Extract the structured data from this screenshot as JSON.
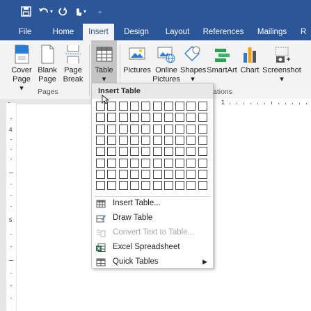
{
  "qat": {
    "save_icon": "save-icon",
    "undo_icon": "undo-icon",
    "redo_icon": "redo-icon",
    "touch_icon": "touch-mode-icon",
    "customize_icon": "customize-qat-icon"
  },
  "tabs": [
    {
      "label": "File"
    },
    {
      "label": "Home"
    },
    {
      "label": "Insert"
    },
    {
      "label": "Design"
    },
    {
      "label": "Layout"
    },
    {
      "label": "References"
    },
    {
      "label": "Mailings"
    },
    {
      "label": "R"
    }
  ],
  "ribbon": {
    "buttons": [
      {
        "label1": "Cover",
        "label2": "Page ▾"
      },
      {
        "label1": "Blank",
        "label2": "Page"
      },
      {
        "label1": "Page",
        "label2": "Break"
      },
      {
        "label1": "Table",
        "label2": "▾"
      },
      {
        "label1": "Pictures",
        "label2": ""
      },
      {
        "label1": "Online",
        "label2": "Pictures"
      },
      {
        "label1": "Shapes",
        "label2": "▾"
      },
      {
        "label1": "SmartArt",
        "label2": ""
      },
      {
        "label1": "Chart",
        "label2": ""
      },
      {
        "label1": "Screenshot",
        "label2": "▾"
      }
    ],
    "groups": {
      "pages": "Pages",
      "illustrations_partial": "ations"
    }
  },
  "dropdown": {
    "header": "Insert Table",
    "grid_cols": 10,
    "grid_rows": 8,
    "items": [
      {
        "label": "Insert Table...",
        "icon": "insert-table-icon",
        "disabled": false,
        "submenu": false
      },
      {
        "label": "Draw Table",
        "icon": "draw-table-icon",
        "disabled": false,
        "submenu": false
      },
      {
        "label": "Convert Text to Table...",
        "icon": "convert-text-icon",
        "disabled": true,
        "submenu": false
      },
      {
        "label": "Excel Spreadsheet",
        "icon": "excel-icon",
        "disabled": false,
        "submenu": false
      },
      {
        "label": "Quick Tables",
        "icon": "quick-tables-icon",
        "disabled": false,
        "submenu": true
      }
    ],
    "submenu_arrow": "▶"
  },
  "ruler": {
    "numbers": [
      "1",
      "4",
      "5"
    ]
  }
}
